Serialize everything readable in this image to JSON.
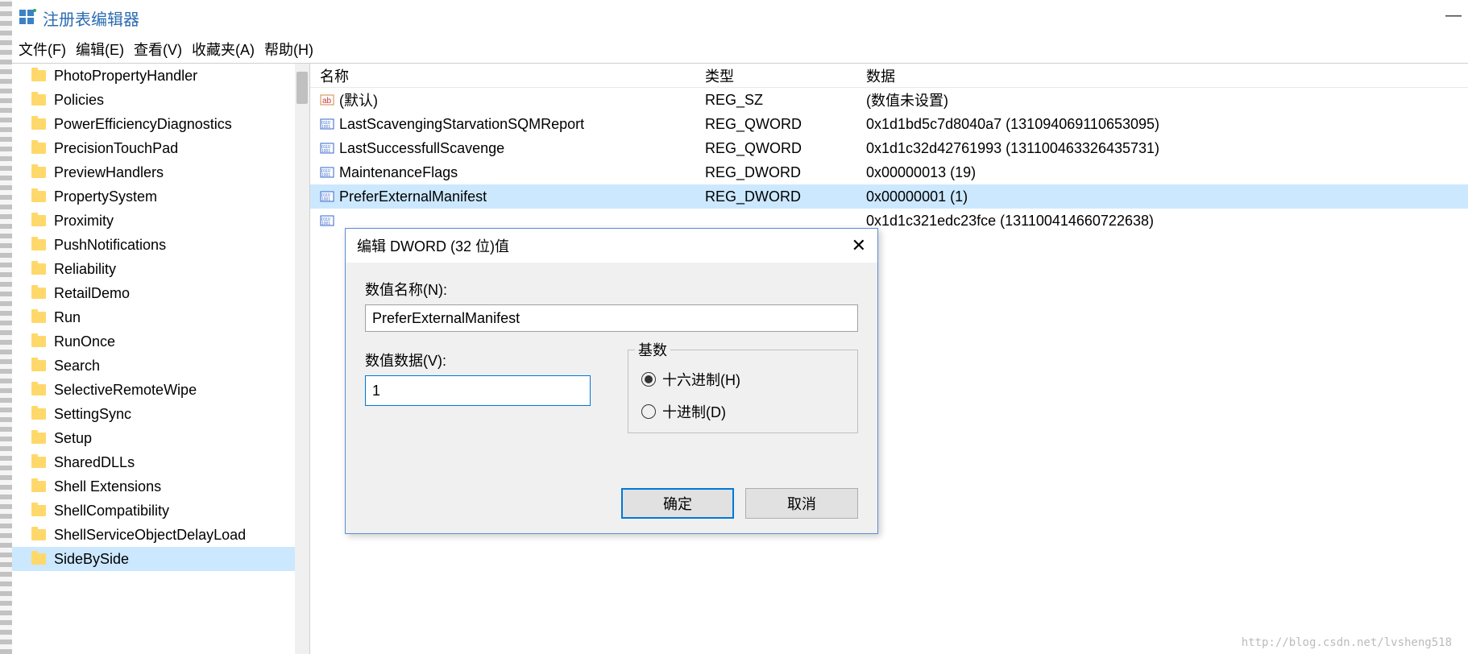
{
  "window": {
    "title": "注册表编辑器"
  },
  "menu": {
    "file": "文件(F)",
    "edit": "编辑(E)",
    "view": "查看(V)",
    "favorites": "收藏夹(A)",
    "help": "帮助(H)"
  },
  "tree": {
    "items": [
      "PhotoPropertyHandler",
      "Policies",
      "PowerEfficiencyDiagnostics",
      "PrecisionTouchPad",
      "PreviewHandlers",
      "PropertySystem",
      "Proximity",
      "PushNotifications",
      "Reliability",
      "RetailDemo",
      "Run",
      "RunOnce",
      "Search",
      "SelectiveRemoteWipe",
      "SettingSync",
      "Setup",
      "SharedDLLs",
      "Shell Extensions",
      "ShellCompatibility",
      "ShellServiceObjectDelayLoad",
      "SideBySide"
    ],
    "selected": "SideBySide"
  },
  "list": {
    "headers": {
      "name": "名称",
      "type": "类型",
      "data": "数据"
    },
    "rows": [
      {
        "icon": "ab",
        "name": "(默认)",
        "type": "REG_SZ",
        "data": "(数值未设置)"
      },
      {
        "icon": "bin",
        "name": "LastScavengingStarvationSQMReport",
        "type": "REG_QWORD",
        "data": "0x1d1bd5c7d8040a7 (131094069110653095)"
      },
      {
        "icon": "bin",
        "name": "LastSuccessfullScavenge",
        "type": "REG_QWORD",
        "data": "0x1d1c32d42761993 (131100463326435731)"
      },
      {
        "icon": "bin",
        "name": "MaintenanceFlags",
        "type": "REG_DWORD",
        "data": "0x00000013 (19)"
      },
      {
        "icon": "bin",
        "name": "PreferExternalManifest",
        "type": "REG_DWORD",
        "data": "0x00000001 (1)"
      },
      {
        "icon": "bin",
        "name": "",
        "type": "",
        "data": "0x1d1c321edc23fce (131100414660722638)"
      }
    ],
    "selected_index": 4
  },
  "dialog": {
    "title": "编辑 DWORD (32 位)值",
    "name_label": "数值名称(N):",
    "name_value": "PreferExternalManifest",
    "value_label": "数值数据(V):",
    "value_value": "1",
    "base_label": "基数",
    "radio_hex": "十六进制(H)",
    "radio_dec": "十进制(D)",
    "ok": "确定",
    "cancel": "取消"
  },
  "watermark": "http://blog.csdn.net/lvsheng518"
}
